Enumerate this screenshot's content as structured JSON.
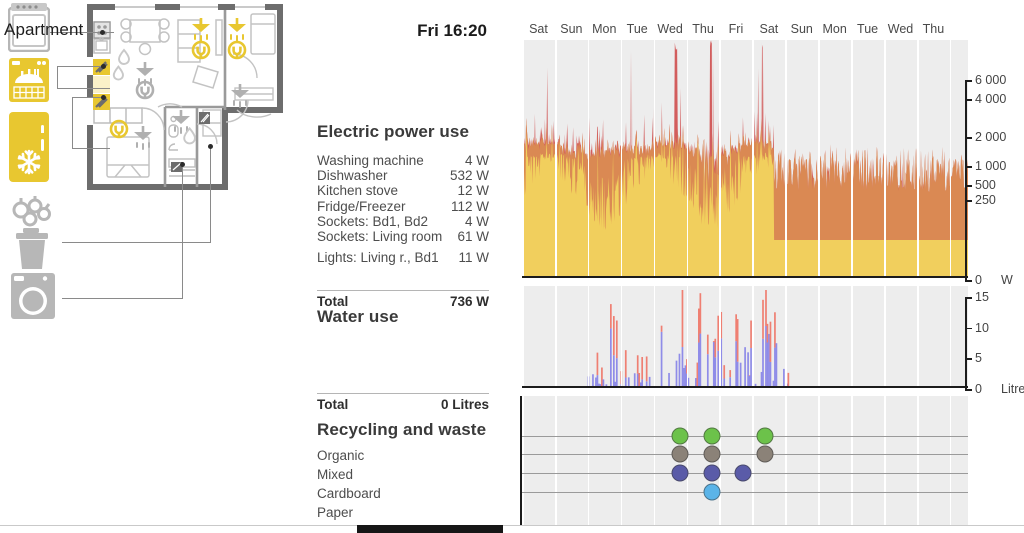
{
  "header": {
    "apartment_title": "Apartment",
    "clock": "Fri 16:20"
  },
  "appliance_icons": [
    {
      "name": "kitchen-stove-icon",
      "color": "#b0b0b0"
    },
    {
      "name": "dishwasher-icon",
      "color": "#e8c730"
    },
    {
      "name": "fridge-icon",
      "color": "#e8c730"
    },
    {
      "name": "freezer-icon",
      "color": "#e8c730"
    },
    {
      "name": "organic-waste-icon",
      "color": "#b7b7b7"
    },
    {
      "name": "trash-bin-icon",
      "color": "#b7b7b7"
    },
    {
      "name": "washing-machine-icon",
      "color": "#b7b7b7"
    }
  ],
  "electric": {
    "title": "Electric power use",
    "items": [
      {
        "label": "Washing machine",
        "value": "4 W"
      },
      {
        "label": "Dishwasher",
        "value": "532 W"
      },
      {
        "label": "Kitchen stove",
        "value": "12 W"
      },
      {
        "label": "Fridge/Freezer",
        "value": "112 W"
      },
      {
        "label": "Sockets: Bd1, Bd2",
        "value": "4 W"
      },
      {
        "label": "Sockets: Living room",
        "value": "61 W"
      },
      {
        "label": "Lights: Living r., Bd1",
        "value": "11 W"
      }
    ],
    "total_label": "Total",
    "total_value": "736 W"
  },
  "water": {
    "title": "Water use",
    "total_label": "Total",
    "total_value": "0 Litres"
  },
  "recycling": {
    "title": "Recycling and waste",
    "rows": [
      {
        "label": "Organic",
        "color": "#6cc24a"
      },
      {
        "label": "Mixed",
        "color": "#8b8278"
      },
      {
        "label": "Cardboard",
        "color": "#5a5ba8"
      },
      {
        "label": "Paper",
        "color": "#5bb4e8"
      }
    ]
  },
  "chart_data": [
    {
      "type": "area",
      "title": "Electric power use",
      "ylabel": "W",
      "unit": "W",
      "scale": "log-like",
      "yticks": [
        {
          "label": "6 000",
          "pos": 0.0
        },
        {
          "label": "4 000",
          "pos": 0.095
        },
        {
          "label": "2 000",
          "pos": 0.285
        },
        {
          "label": "1 000",
          "pos": 0.43
        },
        {
          "label": "500",
          "pos": 0.525
        },
        {
          "label": "250",
          "pos": 0.6
        },
        {
          "label": "0",
          "pos": 1.0
        }
      ],
      "series": [
        {
          "name": "base-yellow",
          "color": "#f2d35e"
        },
        {
          "name": "mid-orange",
          "color": "#da8b52"
        },
        {
          "name": "peak-red",
          "color": "#cf5050"
        }
      ],
      "xlabels": [
        "Sat",
        "Sun",
        "Mon",
        "Tue",
        "Wed",
        "Thu",
        "Fri",
        "Sat",
        "Sun",
        "Mon",
        "Tue",
        "Wed",
        "Thu"
      ]
    },
    {
      "type": "bar",
      "title": "Water use",
      "ylabel": "Litres",
      "unit": "Litres",
      "yticks": [
        {
          "label": "15",
          "pos": 0.0
        },
        {
          "label": "10",
          "pos": 0.333
        },
        {
          "label": "5",
          "pos": 0.666
        },
        {
          "label": "0",
          "pos": 1.0
        }
      ],
      "series": [
        {
          "name": "cold-water",
          "color": "#8f8ce8"
        },
        {
          "name": "hot-water",
          "color": "#ef7f72"
        }
      ],
      "xlabels": [
        "Sat",
        "Sun",
        "Mon",
        "Tue",
        "Wed",
        "Thu",
        "Fri",
        "Sat",
        "Sun",
        "Mon",
        "Tue",
        "Wed",
        "Thu"
      ]
    },
    {
      "type": "scatter",
      "title": "Recycling and waste",
      "categories": [
        "Organic",
        "Mixed",
        "Cardboard",
        "Paper"
      ],
      "events": [
        {
          "category": "Organic",
          "day": "Wed",
          "x": 0.355
        },
        {
          "category": "Organic",
          "day": "Thu",
          "x": 0.425
        },
        {
          "category": "Organic",
          "day": "Sat",
          "x": 0.545
        },
        {
          "category": "Mixed",
          "day": "Wed",
          "x": 0.355
        },
        {
          "category": "Mixed",
          "day": "Thu",
          "x": 0.425
        },
        {
          "category": "Mixed",
          "day": "Sat",
          "x": 0.545
        },
        {
          "category": "Cardboard",
          "day": "Wed",
          "x": 0.355
        },
        {
          "category": "Cardboard",
          "day": "Thu",
          "x": 0.425
        },
        {
          "category": "Cardboard",
          "day": "Fri",
          "x": 0.495
        },
        {
          "category": "Paper",
          "day": "Thu",
          "x": 0.425
        }
      ]
    }
  ],
  "axis": {
    "power_unit": "W",
    "water_unit": "Litres"
  },
  "days": [
    "Sat",
    "Sun",
    "Mon",
    "Tue",
    "Wed",
    "Thu",
    "Fri",
    "Sat",
    "Sun",
    "Mon",
    "Tue",
    "Wed",
    "Thu"
  ],
  "colors": {
    "panel_bg": "#ededed",
    "gridline": "#ffffff",
    "axis": "#1c1c1c",
    "accent_yellow": "#e8c730"
  }
}
